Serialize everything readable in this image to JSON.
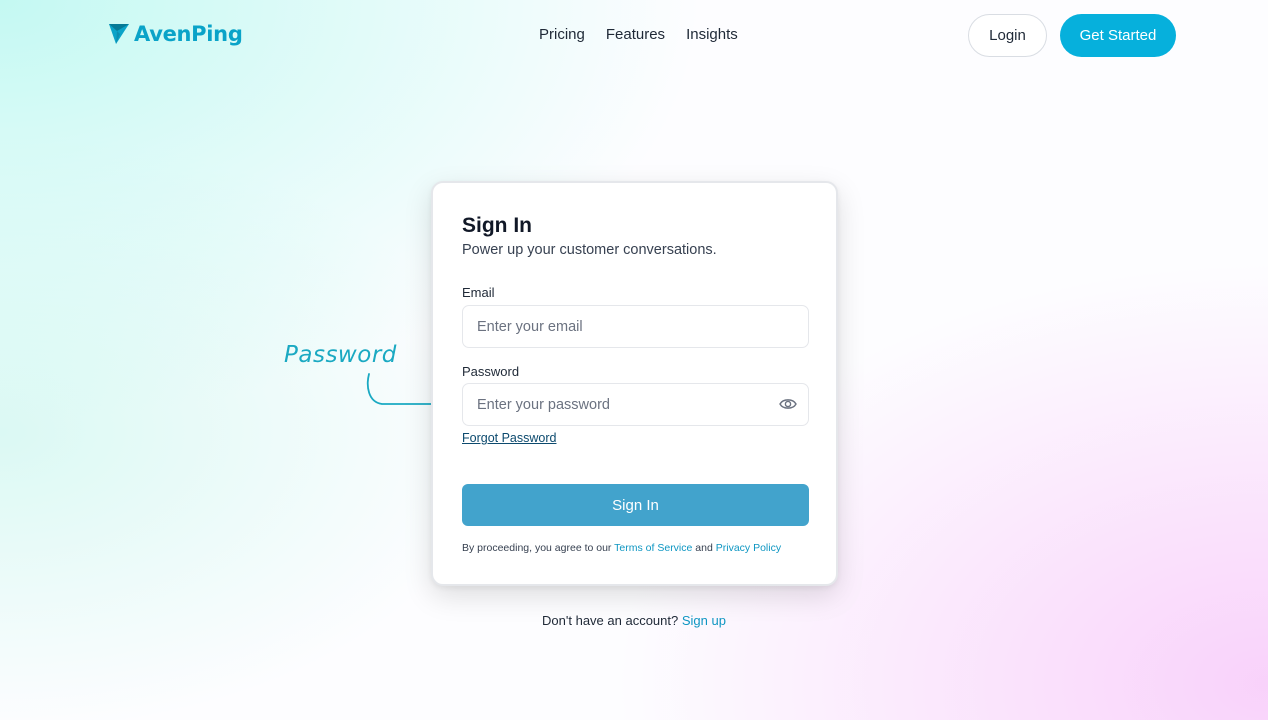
{
  "brand": {
    "name": "AvenPing",
    "color": "#0aa3c8"
  },
  "nav": {
    "links": [
      "Pricing",
      "Features",
      "Insights"
    ],
    "login_label": "Login",
    "get_started_label": "Get Started"
  },
  "signin": {
    "title": "Sign In",
    "subtitle": "Power up your customer conversations.",
    "email_label": "Email",
    "email_placeholder": "Enter your email",
    "email_value": "",
    "password_label": "Password",
    "password_placeholder": "Enter your password",
    "password_value": "",
    "forgot_label": "Forgot Password",
    "submit_label": "Sign In",
    "legal_prefix": "By proceeding, you agree to our",
    "terms_label": "Terms of Service",
    "legal_and": "and",
    "privacy_label": "Privacy Policy"
  },
  "footer": {
    "prompt": "Don't have an account?",
    "signup_label": "Sign up"
  },
  "annotation": {
    "text": "Password"
  },
  "icons": {
    "logo": "paper-plane-icon",
    "password_toggle": "eye-icon",
    "annotation_arrow": "arrow-right-icon"
  },
  "colors": {
    "accent": "#06b0dc",
    "signin_button": "#42a3cc",
    "link": "#0e96c2",
    "annotation": "#1aa9c2"
  }
}
